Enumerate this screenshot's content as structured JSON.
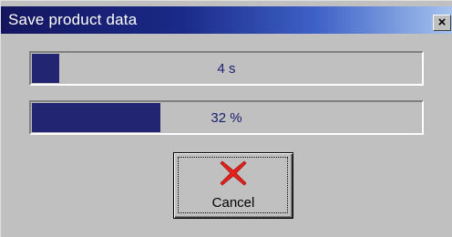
{
  "window": {
    "title": "Save product data",
    "close_glyph": "×"
  },
  "progress_time": {
    "label": "4 s",
    "fraction": 0.07
  },
  "progress_percent": {
    "label": "32 %",
    "fraction": 0.33
  },
  "cancel_button": {
    "label": "Cancel",
    "icon": "red-x-icon"
  },
  "colors": {
    "title_gradient_start": "#14155e",
    "title_gradient_end": "#a6c4ee",
    "progress_fill": "#212572",
    "progress_text": "#1a2070",
    "window_bg": "#c0c0c0",
    "cancel_icon": "#e8211c"
  }
}
